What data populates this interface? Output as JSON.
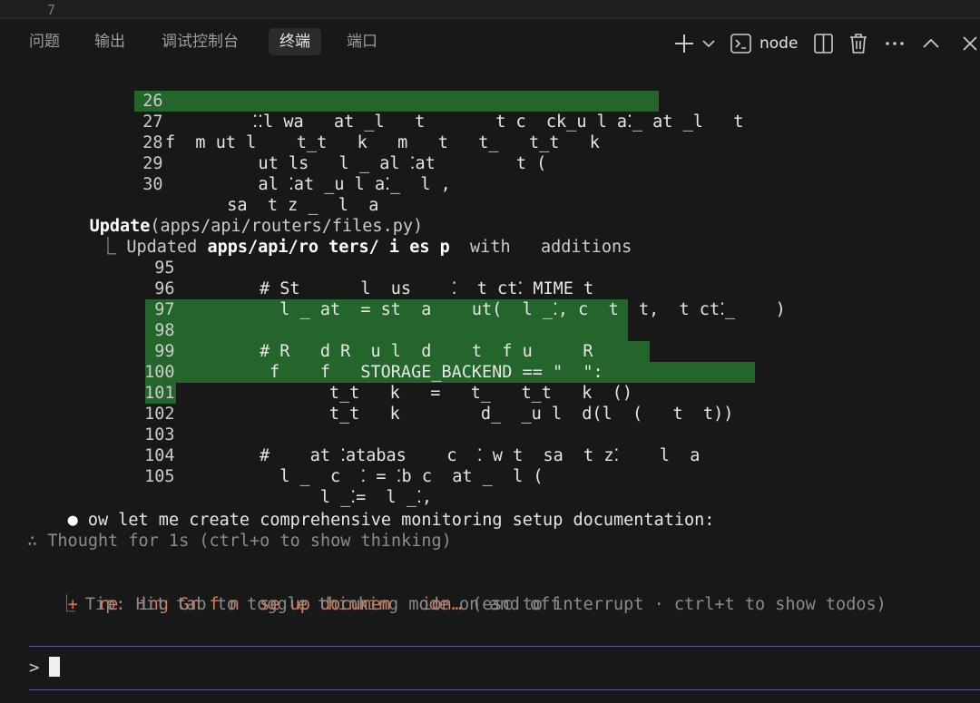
{
  "editor": {
    "line_number": "7"
  },
  "panel": {
    "tabs": [
      {
        "label": "问题"
      },
      {
        "label": "输出"
      },
      {
        "label": "调试控制台"
      },
      {
        "label": "终端",
        "active": true
      },
      {
        "label": "端口"
      }
    ],
    "shell_label": "node"
  },
  "terminal": {
    "block1": [
      {
        "n": "26",
        "code": "  ⁚⁚l wa   at _l   t       t c  ck_u l a⁚_ at _l   t"
      },
      {
        "n": "27",
        "code": "f  m ut l    t_t   k   m   t   t_   t_t   k",
        "hl": true
      },
      {
        "n": "28",
        "code": "    ut ls   l _ al ⁚at        t ("
      },
      {
        "n": "29",
        "code": "    al ⁚at _u l a⁚_  l ,"
      },
      {
        "n": "30",
        "code": "  sa  t z _  l  a"
      }
    ],
    "update_title_bold": "Update",
    "update_title_rest": "(apps/api/routers/files.py)",
    "updated_prefix": " ⎿ Updated ",
    "updated_file": "apps/api/ro ters/ i es p",
    "updated_suffix": "  with   additions",
    "block2": [
      {
        "n": "95",
        "code": "# St      l  us    ⁚  t ct⁚ MIME t"
      },
      {
        "n": "96",
        "code": "  l _ at  = st  a    ut(  l _⁚, c  t  t,  t ct⁚_    )"
      },
      {
        "n": "97",
        "code": ""
      },
      {
        "n": "98",
        "code": "# R   d R  u l  d    t  f u     R",
        "hl": true
      },
      {
        "n": "99",
        "code": " f    f   STORAGE_BACKEND == \"  \":",
        "hl": true
      },
      {
        "n": "100",
        "code": "      t_t   k   =   t_   t_t   k  ()",
        "hl": true
      },
      {
        "n": "101",
        "code": "      t_t   k        d_  _u l  d(l  (   t  t))",
        "hl": true
      },
      {
        "n": "102",
        "code": "",
        "hl": true
      },
      {
        "n": "103",
        "code": "#    at ⁚atabas    c  ⁚ w t  sa  t z⁚    l  a"
      },
      {
        "n": "104",
        "code": "  l _  c  ⁚ = ⁚b c  at _  l ("
      },
      {
        "n": "105",
        "code": "      l _⁚=  l _⁚,"
      }
    ],
    "bullet": "●",
    "message": "ow let me create comprehensive monitoring setup documentation:",
    "thought": "∴ Thought for 1s (ctrl+o to show thinking)",
    "status_icon": "+",
    "status_text": "re  ing Gr f n  se up documen   ion…",
    "status_hint": "(esc to interrupt · ctrl+t to show todos)",
    "tip": "  ⎿ Tip: Hit tab to toggle thinking mode on and off",
    "prompt": ">"
  },
  "colors": {
    "background": "#181818",
    "diff_added": "#24652c",
    "status_orange": "#e07b53",
    "prompt_border": "#5b5b9a"
  }
}
